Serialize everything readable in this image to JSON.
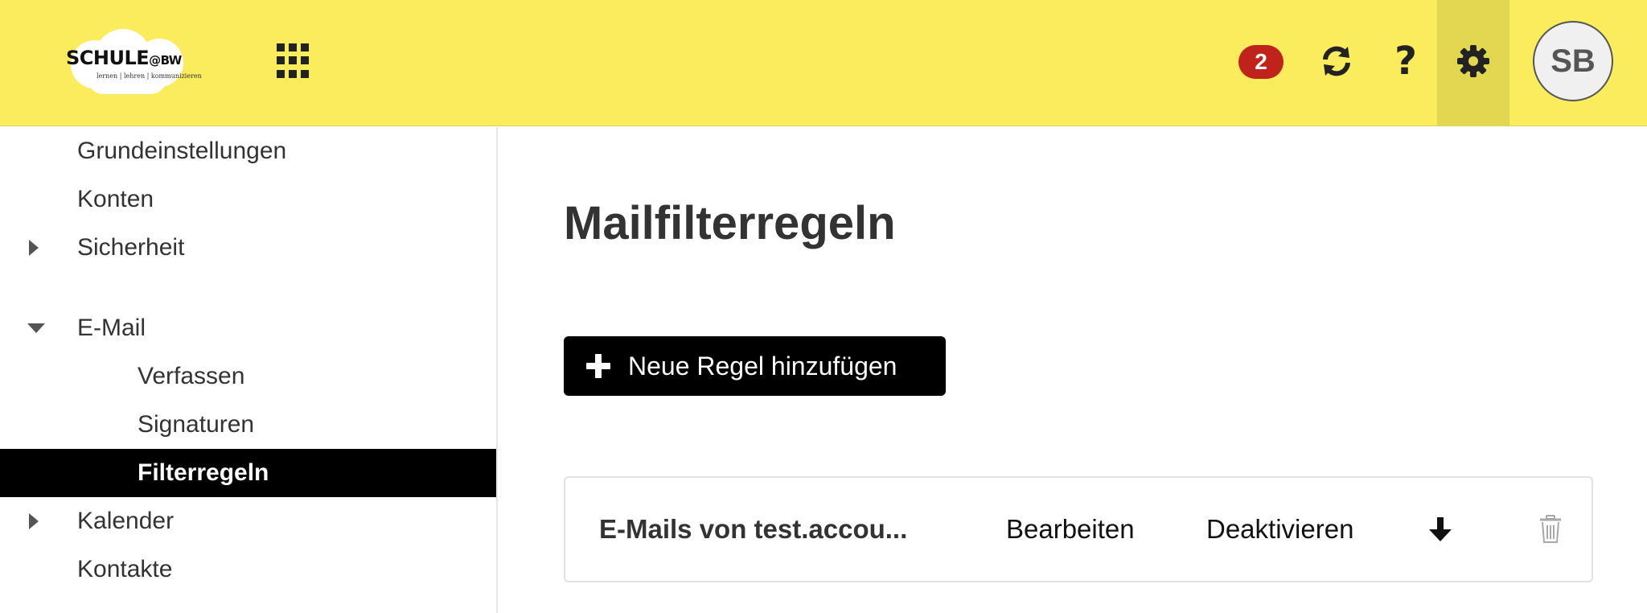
{
  "header": {
    "logo": {
      "brand_main": "SCHULE",
      "brand_suffix": "@BW",
      "tagline": "lernen | lehren | kommunizieren"
    },
    "apps_icon": "apps-grid-icon",
    "notification_count": "2",
    "refresh_icon": "refresh-icon",
    "help_label": "?",
    "settings_icon": "gear-icon",
    "avatar_initials": "SB",
    "colors": {
      "background": "#fbec5d",
      "active_tab": "#e3d650",
      "badge": "#c0231b"
    }
  },
  "sidebar": {
    "items": [
      {
        "label": "Grundeinstellungen",
        "level": 1,
        "caret": "none"
      },
      {
        "label": "Konten",
        "level": 1,
        "caret": "none"
      },
      {
        "label": "Sicherheit",
        "level": 1,
        "caret": "collapsed"
      },
      {
        "label": "E-Mail",
        "level": 1,
        "caret": "expanded"
      },
      {
        "label": "Verfassen",
        "level": 2,
        "caret": "none"
      },
      {
        "label": "Signaturen",
        "level": 2,
        "caret": "none"
      },
      {
        "label": "Filterregeln",
        "level": 2,
        "caret": "none",
        "active": true
      },
      {
        "label": "Kalender",
        "level": 1,
        "caret": "collapsed"
      },
      {
        "label": "Kontakte",
        "level": 1,
        "caret": "none"
      }
    ]
  },
  "main": {
    "title": "Mailfilterregeln",
    "add_button_label": "Neue Regel hinzufügen",
    "rules": [
      {
        "name": "E-Mails von test.accou...",
        "edit_label": "Bearbeiten",
        "toggle_label": "Deaktivieren",
        "move_icon": "arrow-down-icon",
        "delete_icon": "trash-icon"
      }
    ]
  }
}
